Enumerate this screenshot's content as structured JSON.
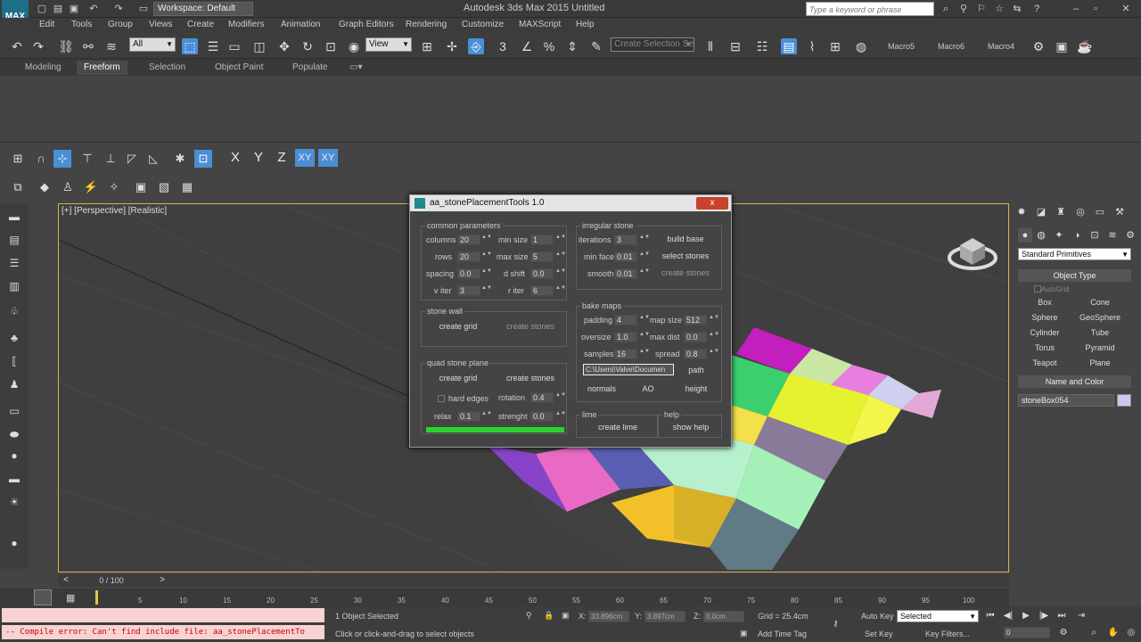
{
  "titlebar": {
    "logo": "MAX",
    "workspace": "Workspace: Default",
    "window_title": "Autodesk 3ds Max 2015      Untitled",
    "search_placeholder": "Type a keyword or phrase"
  },
  "menu": [
    "Edit",
    "Tools",
    "Group",
    "Views",
    "Create",
    "Modifiers",
    "Animation",
    "Graph Editors",
    "Rendering",
    "Customize",
    "MAXScript",
    "Help"
  ],
  "main_toolbar": {
    "selection_filter": "All",
    "ref_coord": "View",
    "named_selection": "Create Selection Se",
    "macros": [
      "Macro5",
      "Macro6",
      "Macro4"
    ]
  },
  "ribbon_tabs": [
    "Modeling",
    "Freeform",
    "Selection",
    "Object Paint",
    "Populate"
  ],
  "ribbon_active": "Freeform",
  "axis_buttons": [
    "X",
    "Y",
    "Z",
    "XY",
    "XY"
  ],
  "viewport": {
    "label": "[+] [Perspective] [Realistic]"
  },
  "dialog": {
    "title": "aa_stonePlacementTools 1.0",
    "close": "x",
    "common": {
      "label": "common parameters",
      "columns_label": "columns",
      "columns": "20",
      "rows_label": "rows",
      "rows": "20",
      "spacing_label": "spacing",
      "spacing": "0.0",
      "viter_label": "v iter",
      "viter": "3",
      "minsize_label": "min size",
      "minsize": "1",
      "maxsize_label": "max size",
      "maxsize": "5",
      "dshift_label": "d shift",
      "dshift": "0.0",
      "riter_label": "r iter",
      "riter": "6"
    },
    "stone_wall": {
      "label": "stone wall",
      "create_grid": "create grid",
      "create_stones": "create stones"
    },
    "quad": {
      "label": "quad stone plane",
      "create_grid": "create grid",
      "create_stones": "create stones",
      "hard_edges": "hard edges",
      "rotation_label": "rotation",
      "rotation": "0.4",
      "relax_label": "relax",
      "relax": "0.1",
      "strenght_label": "strenght",
      "strenght": "0.0"
    },
    "progress": 1.0,
    "irregular": {
      "label": "irregular stone",
      "iterations_label": "iterations",
      "iterations": "3",
      "minface_label": "min face",
      "minface": "0.01",
      "smooth_label": "smooth",
      "smooth": "0.01",
      "build_base": "build base",
      "select_stones": "select stones",
      "create_stones": "create stones"
    },
    "bake": {
      "label": "bake maps",
      "padding_label": "padding",
      "padding": "4",
      "oversize_label": "oversize",
      "oversize": "1.0",
      "samples_label": "samples",
      "samples": "16",
      "mapsize_label": "map size",
      "mapsize": "512",
      "maxdist_label": "max dist",
      "maxdist": "0.0",
      "spread_label": "spread",
      "spread": "0.8",
      "path_value": "C:\\Users\\Valve\\Documen",
      "path_btn": "path",
      "normals": "normals",
      "ao": "AO",
      "height": "height"
    },
    "lime": {
      "label": "lime",
      "create_lime": "create lime"
    },
    "help": {
      "label": "help",
      "show_help": "show help"
    }
  },
  "command_panel": {
    "dropdown": "Standard Primitives",
    "object_type": "Object Type",
    "autogrid": "AutoGrid",
    "buttons": [
      "Box",
      "Cone",
      "Sphere",
      "GeoSphere",
      "Cylinder",
      "Tube",
      "Torus",
      "Pyramid",
      "Teapot",
      "Plane"
    ],
    "name_color": "Name and Color",
    "name": "stoneBox054"
  },
  "timeline": {
    "slider": "0 / 100",
    "ticks": [
      "5",
      "10",
      "15",
      "20",
      "25",
      "30",
      "35",
      "40",
      "45",
      "50",
      "55",
      "60",
      "65",
      "70",
      "75",
      "80",
      "85",
      "90",
      "95",
      "100"
    ]
  },
  "status": {
    "error": "-- Compile error: Can't find include file:  aa_stonePlacementTo",
    "selected": "1 Object Selected",
    "hint": "Click or click-and-drag to select objects",
    "x_label": "X:",
    "x": "33.896cm",
    "y_label": "Y:",
    "y": "3.897cm",
    "z_label": "Z:",
    "z": "0.0cm",
    "grid": "Grid = 25.4cm",
    "add_time_tag": "Add Time Tag",
    "auto_key": "Auto Key",
    "set_key": "Set Key",
    "key_filters": "Key Filters...",
    "key_mode": "Selected",
    "frame": "0"
  },
  "colors": {
    "accent": "#4a8fd6",
    "viewport_border": "#d6b64a",
    "progress": "#2ad42a",
    "close": "#c7422f"
  }
}
